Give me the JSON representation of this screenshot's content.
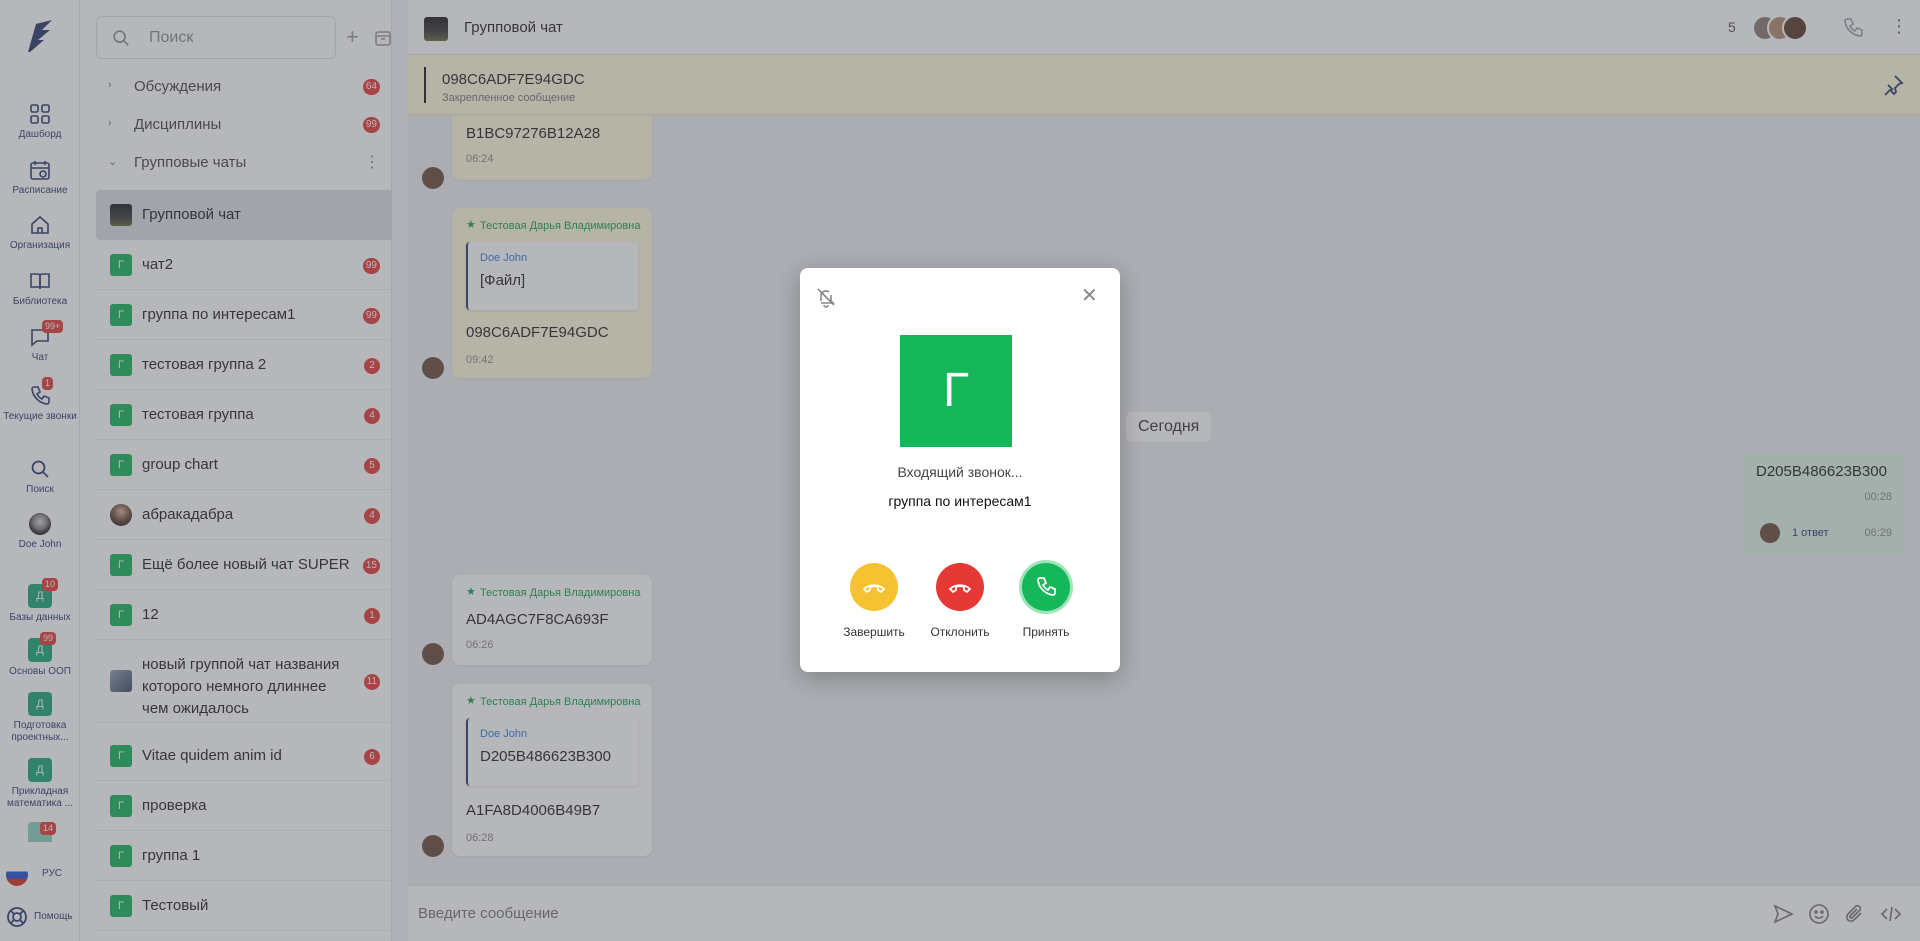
{
  "rail": {
    "items": [
      {
        "label": "Дашборд"
      },
      {
        "label": "Расписание"
      },
      {
        "label": "Организация"
      },
      {
        "label": "Библиотека"
      },
      {
        "label": "Чат",
        "badge": "99+"
      },
      {
        "label": "Текущие звонки",
        "badge": "1"
      },
      {
        "label": "Поиск"
      },
      {
        "label": "Doe John"
      }
    ],
    "databases": [
      {
        "tile": "Д",
        "label": "Базы данных",
        "badge": "10"
      },
      {
        "tile": "Д",
        "label": "Основы ООП",
        "badge": "99"
      },
      {
        "tile": "Д",
        "label": "Подготовка проектных..."
      },
      {
        "tile": "Д",
        "label": "Прикладная математика ..."
      },
      {
        "tile": "",
        "label": "",
        "badge": "14"
      }
    ],
    "lang": "РУС",
    "help": "Помощь"
  },
  "chatlist": {
    "search_placeholder": "Поиск",
    "sections": [
      {
        "label": "Обсуждения",
        "count": "64"
      },
      {
        "label": "Дисциплины",
        "count": "99"
      },
      {
        "label": "Групповые чаты"
      }
    ],
    "items": [
      {
        "avatar": "",
        "name": "Групповой чат",
        "count": ""
      },
      {
        "avatar": "Г",
        "name": "чат2",
        "count": "99"
      },
      {
        "avatar": "Г",
        "name": "группа по интересам1",
        "count": "99"
      },
      {
        "avatar": "Г",
        "name": "тестовая группа 2",
        "count": "2"
      },
      {
        "avatar": "Г",
        "name": "тестовая группа",
        "count": "4"
      },
      {
        "avatar": "Г",
        "name": "group chart",
        "count": "5"
      },
      {
        "avatar": "",
        "name": "абракадабра",
        "count": "4"
      },
      {
        "avatar": "Г",
        "name": "Ещё более новый чат SUPER",
        "count": "15"
      },
      {
        "avatar": "Г",
        "name": "12",
        "count": "1"
      },
      {
        "avatar": "",
        "name": "новый группой чат названия которого немного длиннее чем ожидалось",
        "count": "11"
      },
      {
        "avatar": "Г",
        "name": "Vitae quidem anim id",
        "count": "6"
      },
      {
        "avatar": "Г",
        "name": "проверка",
        "count": ""
      },
      {
        "avatar": "Г",
        "name": "группа 1",
        "count": ""
      },
      {
        "avatar": "Г",
        "name": "Тестовый",
        "count": ""
      }
    ]
  },
  "header": {
    "title": "Групповой чат",
    "members": "5"
  },
  "pinned": {
    "value": "098C6ADF7E94GDC",
    "label": "Закрепленное сообщение"
  },
  "messages": {
    "m1": {
      "code": "B1BC97276B12A28",
      "time": "06:24"
    },
    "m2": {
      "author": "Тестовая Дарья Владимировна",
      "quote_author": "Doe John",
      "quote_text": "[Файл]",
      "code": "098C6ADF7E94GDC",
      "time": "09:42"
    },
    "today": "Сегодня",
    "outgoing": {
      "code": "D205B486623B300",
      "time": "00:28",
      "reply": "1 ответ",
      "reply_time": "06:29"
    },
    "m3": {
      "author": "Тестовая Дарья Владимировна",
      "code": "AD4AGC7F8CA693F",
      "time": "06:26"
    },
    "m4": {
      "author": "Тестовая Дарья Владимировна",
      "quote_author": "Doe John",
      "quote_text": "D205B486623B300",
      "code": "A1FA8D4006B49B7",
      "time": "06:28"
    }
  },
  "composer": {
    "placeholder": "Введите сообщение"
  },
  "call": {
    "avatar_letter": "Г",
    "status": "Входящий звонок...",
    "name": "группа по интересам1",
    "end_label": "Завершить",
    "decline_label": "Отклонить",
    "accept_label": "Принять",
    "colors": {
      "end": "#f5c232",
      "decline": "#e53935",
      "accept": "#16b65a"
    }
  }
}
